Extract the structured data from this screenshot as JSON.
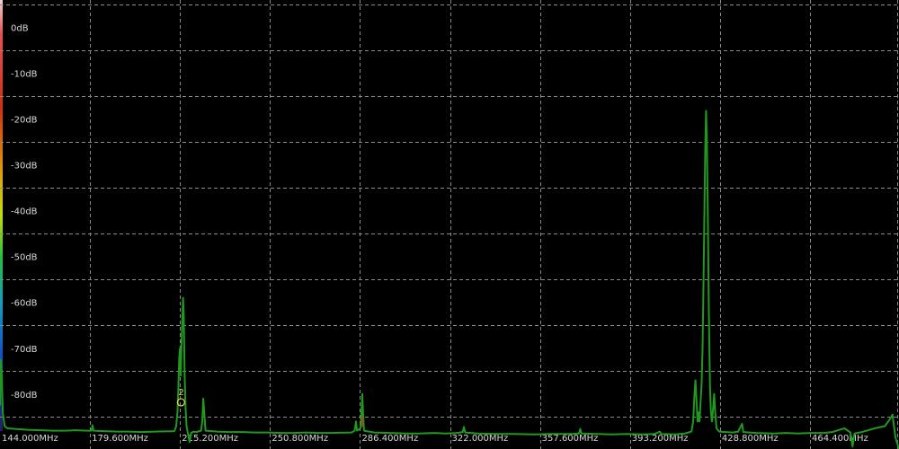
{
  "chart_data": {
    "type": "line",
    "title": "",
    "xlabel": "",
    "ylabel": "",
    "xlim": [
      144.0,
      499.6
    ],
    "ylim": [
      -92,
      6
    ],
    "grid": true,
    "y_ticks": [
      {
        "value": 0,
        "label": "0dB"
      },
      {
        "value": -10,
        "label": "-10dB"
      },
      {
        "value": -20,
        "label": "-20dB"
      },
      {
        "value": -30,
        "label": "-30dB"
      },
      {
        "value": -40,
        "label": "-40dB"
      },
      {
        "value": -50,
        "label": "-50dB"
      },
      {
        "value": -60,
        "label": "-60dB"
      },
      {
        "value": -70,
        "label": "-70dB"
      },
      {
        "value": -80,
        "label": "-80dB"
      }
    ],
    "x_ticks": [
      {
        "value": 144.0,
        "label": "144.000MHz"
      },
      {
        "value": 179.6,
        "label": "179.600MHz"
      },
      {
        "value": 215.2,
        "label": "215.200MHz"
      },
      {
        "value": 250.8,
        "label": "250.800MHz"
      },
      {
        "value": 286.4,
        "label": "286.400MHz"
      },
      {
        "value": 322.0,
        "label": "322.000MHz"
      },
      {
        "value": 357.6,
        "label": "357.600MHz"
      },
      {
        "value": 393.2,
        "label": "393.200MHz"
      },
      {
        "value": 428.8,
        "label": "428.800MHz"
      },
      {
        "value": 464.4,
        "label": "464.400MHz"
      }
    ],
    "series": [
      {
        "color": "#1f9a1f",
        "points": [
          [
            144.0,
            -82.5
          ],
          [
            144.3,
            -72.5
          ],
          [
            144.7,
            -76
          ],
          [
            145.1,
            -84
          ],
          [
            145.8,
            -87
          ],
          [
            147,
            -87.5
          ],
          [
            150,
            -87.6
          ],
          [
            155,
            -87.8
          ],
          [
            160,
            -87.9
          ],
          [
            165,
            -88
          ],
          [
            170,
            -88
          ],
          [
            174,
            -87.9
          ],
          [
            178,
            -88
          ],
          [
            180.2,
            -88
          ],
          [
            180.6,
            -86.8
          ],
          [
            181.0,
            -88
          ],
          [
            185,
            -88.1
          ],
          [
            190,
            -88.2
          ],
          [
            195,
            -88.2
          ],
          [
            200,
            -88.3
          ],
          [
            205,
            -88.2
          ],
          [
            213,
            -88.1
          ],
          [
            213.7,
            -87
          ],
          [
            214.2,
            -84
          ],
          [
            214.6,
            -78
          ],
          [
            214.9,
            -72
          ],
          [
            215.2,
            -70
          ],
          [
            215.5,
            -76
          ],
          [
            215.8,
            -69
          ],
          [
            216.1,
            -64
          ],
          [
            216.4,
            -59
          ],
          [
            216.7,
            -63
          ],
          [
            217.0,
            -75
          ],
          [
            217.4,
            -83
          ],
          [
            217.8,
            -87
          ],
          [
            218.3,
            -88.5
          ],
          [
            219,
            -90.5
          ],
          [
            219.6,
            -88.5
          ],
          [
            220.5,
            -88.2
          ],
          [
            221.5,
            -88.3
          ],
          [
            223.5,
            -88
          ],
          [
            224.0,
            -86
          ],
          [
            224.4,
            -81
          ],
          [
            224.8,
            -84
          ],
          [
            225.3,
            -88
          ],
          [
            230,
            -88.2
          ],
          [
            235,
            -88.3
          ],
          [
            240,
            -88.3
          ],
          [
            245,
            -88.4
          ],
          [
            250,
            -88.4
          ],
          [
            255,
            -88.5
          ],
          [
            260,
            -88.5
          ],
          [
            265,
            -88.4
          ],
          [
            270,
            -88.5
          ],
          [
            275,
            -88.5
          ],
          [
            283,
            -88.4
          ],
          [
            284.3,
            -88
          ],
          [
            284.8,
            -86
          ],
          [
            285.2,
            -88
          ],
          [
            286.6,
            -87.5
          ],
          [
            287.0,
            -84
          ],
          [
            287.3,
            -80
          ],
          [
            287.6,
            -84
          ],
          [
            288.0,
            -88
          ],
          [
            292,
            -88.4
          ],
          [
            298,
            -88.5
          ],
          [
            305,
            -88.6
          ],
          [
            310,
            -88.6
          ],
          [
            316,
            -88.5
          ],
          [
            320,
            -88.6
          ],
          [
            325,
            -88.5
          ],
          [
            327,
            -88.3
          ],
          [
            327.5,
            -87.2
          ],
          [
            328,
            -88.4
          ],
          [
            333,
            -88.6
          ],
          [
            340,
            -88.7
          ],
          [
            347,
            -88.7
          ],
          [
            355,
            -88.8
          ],
          [
            362,
            -88.7
          ],
          [
            370,
            -88.7
          ],
          [
            373,
            -88.6
          ],
          [
            373.5,
            -87.6
          ],
          [
            374,
            -88.6
          ],
          [
            380,
            -88.7
          ],
          [
            386,
            -88.8
          ],
          [
            392,
            -88.7
          ],
          [
            398,
            -88.8
          ],
          [
            403,
            -88.7
          ],
          [
            405,
            -88.2
          ],
          [
            405.5,
            -88.7
          ],
          [
            411,
            -88.8
          ],
          [
            415,
            -88.6
          ],
          [
            417.5,
            -88.2
          ],
          [
            418.2,
            -86
          ],
          [
            418.7,
            -80
          ],
          [
            419.1,
            -77
          ],
          [
            419.5,
            -81
          ],
          [
            419.9,
            -86
          ],
          [
            420.3,
            -84
          ],
          [
            420.7,
            -86
          ],
          [
            421.1,
            -82
          ],
          [
            421.5,
            -78
          ],
          [
            421.9,
            -70
          ],
          [
            422.3,
            -55
          ],
          [
            422.7,
            -38
          ],
          [
            423.0,
            -25
          ],
          [
            423.3,
            -18.2
          ],
          [
            423.6,
            -25
          ],
          [
            424.0,
            -42
          ],
          [
            424.4,
            -62
          ],
          [
            424.8,
            -78
          ],
          [
            425.2,
            -84
          ],
          [
            425.6,
            -86
          ],
          [
            426.1,
            -83
          ],
          [
            426.5,
            -80
          ],
          [
            426.9,
            -84
          ],
          [
            427.4,
            -87.5
          ],
          [
            428.5,
            -88.2
          ],
          [
            431,
            -88.3
          ],
          [
            434,
            -88.4
          ],
          [
            436,
            -88.2
          ],
          [
            437.5,
            -86.5
          ],
          [
            438,
            -88.3
          ],
          [
            443,
            -88.5
          ],
          [
            450,
            -88.6
          ],
          [
            455,
            -88.5
          ],
          [
            460,
            -88.6
          ],
          [
            465,
            -88.5
          ],
          [
            470,
            -88.5
          ],
          [
            473,
            -88.3
          ],
          [
            475,
            -88
          ],
          [
            478,
            -87.5
          ],
          [
            480.4,
            -88.4
          ],
          [
            481.2,
            -91.5
          ],
          [
            482,
            -88.6
          ],
          [
            485,
            -88.3
          ],
          [
            490,
            -87.5
          ],
          [
            494,
            -87
          ],
          [
            496,
            -85.5
          ],
          [
            497,
            -84.5
          ],
          [
            498.2,
            -89.5
          ],
          [
            499.6,
            -92
          ]
        ]
      }
    ],
    "markers": [
      {
        "label": "2",
        "x": 215.6,
        "y": -81.8,
        "color": "#e8d84a"
      },
      {
        "label": "",
        "x": 287.3,
        "y": -86.0,
        "color": "#cc3322"
      }
    ]
  }
}
